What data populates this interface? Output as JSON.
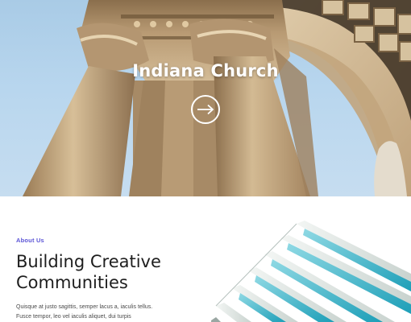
{
  "hero": {
    "title": "Indiana Church",
    "arrow_icon": "arrow-right-circle-icon",
    "sky_color": "#b8d6ee",
    "stone_color": "#c9ae86"
  },
  "about": {
    "eyebrow": "About Us",
    "heading_line1": "Building Creative",
    "heading_line2": "Communities",
    "text_line1": "Quisque at justo sagittis, semper lacus a, iaculis tellus.",
    "text_line2": "Fusce tempor, leo vel iaculis aliquet, dui turpis",
    "accent_color": "#5b54d6"
  },
  "building_art": {
    "glass_color": "#3fb6cc",
    "frame_color": "#e6ece9"
  }
}
